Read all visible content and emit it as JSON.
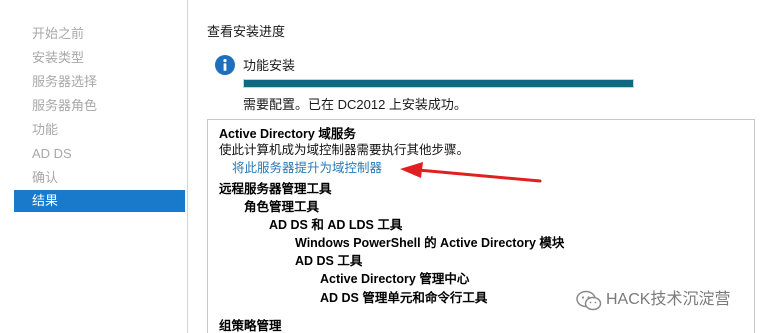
{
  "sidebar": {
    "items": [
      {
        "label": "开始之前"
      },
      {
        "label": "安装类型"
      },
      {
        "label": "服务器选择"
      },
      {
        "label": "服务器角色"
      },
      {
        "label": "功能"
      },
      {
        "label": "AD DS"
      },
      {
        "label": "确认"
      },
      {
        "label": "结果",
        "active": true
      }
    ]
  },
  "main": {
    "heading": "查看安装进度",
    "feature_install": {
      "icon": "info-icon",
      "label": "功能安装",
      "progress": 1.0,
      "status": "需要配置。已在 DC2012 上安装成功。"
    },
    "results": {
      "ad_ds_title": "Active Directory 域服务",
      "ad_ds_desc": "使此计算机成为域控制器需要执行其他步骤。",
      "promote_link": "将此服务器提升为域控制器",
      "rsat_title": "远程服务器管理工具",
      "role_admin_tools": "角色管理工具",
      "ad_ds_lds_tools": "AD DS 和 AD LDS 工具",
      "ps_module": "Windows PowerShell 的 Active Directory 模块",
      "ad_ds_tools": "AD DS 工具",
      "ad_admin_center": "Active Directory 管理中心",
      "ad_ds_snapins": "AD DS 管理单元和命令行工具",
      "group_policy": "组策略管理"
    }
  },
  "annotation": {
    "arrow_color": "#e02020"
  },
  "watermark": {
    "text": "HACK技术沉淀营"
  },
  "colors": {
    "accent": "#1979ca",
    "progress": "#0e6a80",
    "link": "#2a7ab5"
  }
}
